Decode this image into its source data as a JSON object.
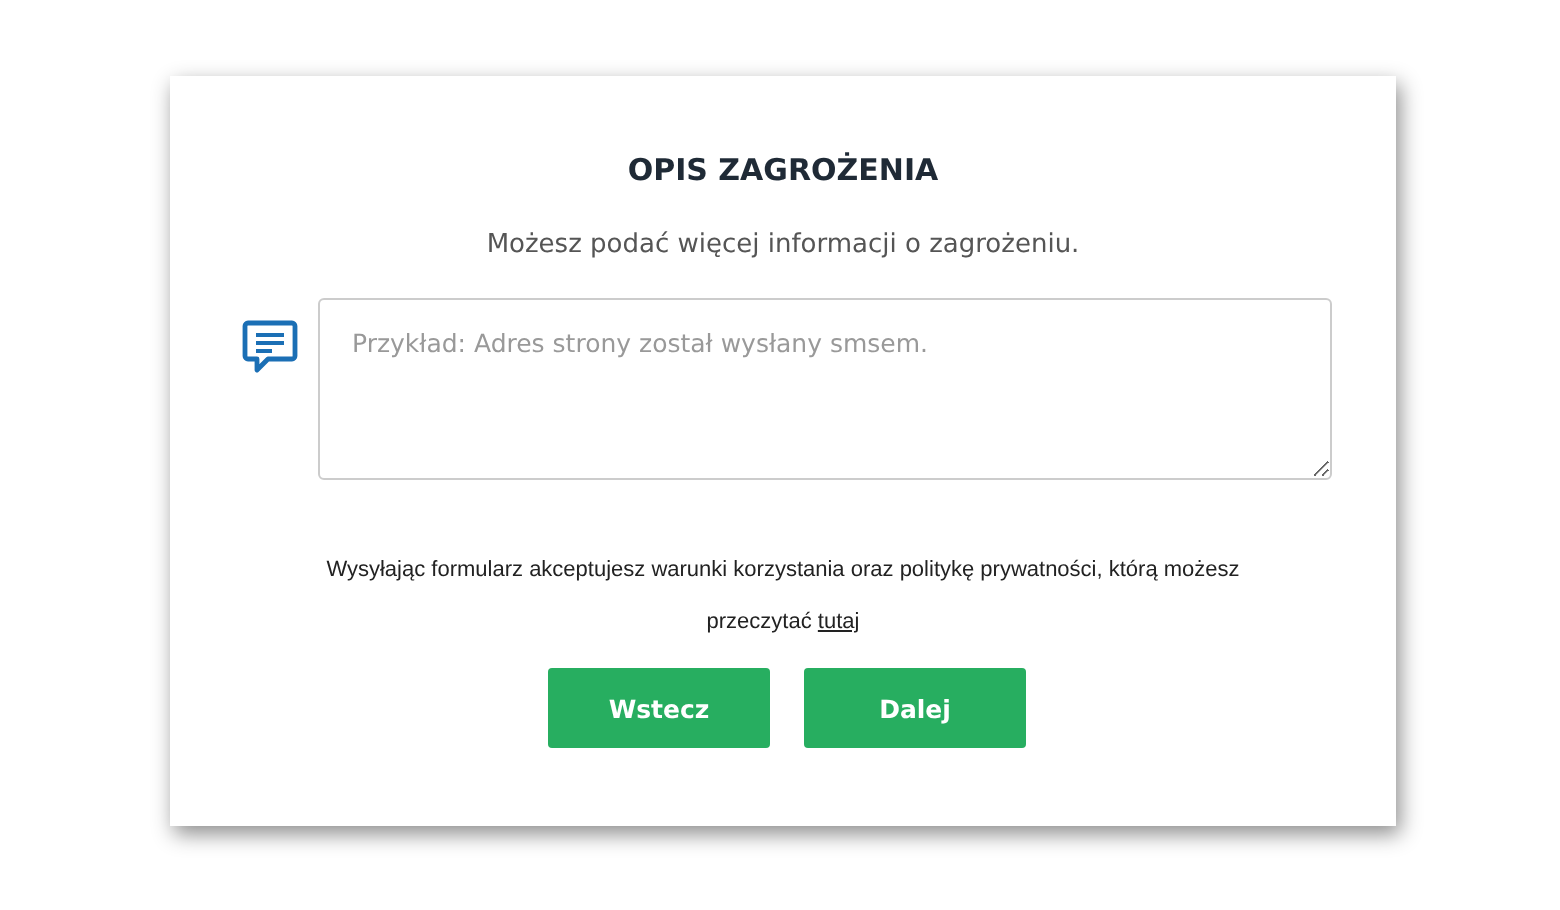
{
  "dialog": {
    "title": "OPIS ZAGROŻENIA",
    "subtitle": "Możesz podać więcej informacji o zagrożeniu.",
    "description_field": {
      "placeholder": "Przykład: Adres strony został wysłany smsem."
    },
    "consent": {
      "text": "Wysyłając formularz akceptujesz warunki korzystania oraz politykę prywatności, którą możesz przeczytać",
      "link": "tutaj"
    },
    "buttons": [
      "Wstecz",
      "Dalej"
    ]
  }
}
